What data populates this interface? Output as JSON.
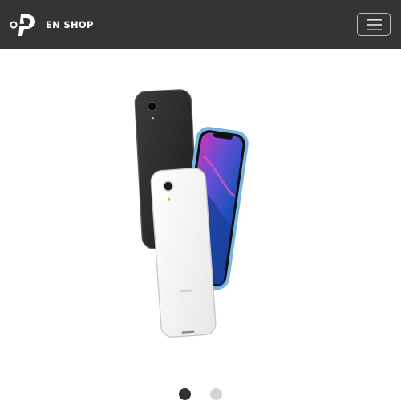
{
  "navbar": {
    "brand_text": "EN SHOP",
    "brand_logo_letters": "OP",
    "toggler_label": "menu-toggle"
  },
  "carousel": {
    "slides": [
      {
        "image": "iphone-xr-product-photo",
        "active": true
      },
      {
        "image": "iphone-xr-product-photo",
        "active": false
      }
    ],
    "active_index": 0
  },
  "colors": {
    "navbar_bg": "#343434",
    "page_bg": "#ffffff",
    "dot_active": "#303030",
    "dot_inactive": "#d3d3d3"
  },
  "icons": {
    "menu": "hamburger-menu-icon",
    "brand": "open-shop-logo-icon"
  }
}
